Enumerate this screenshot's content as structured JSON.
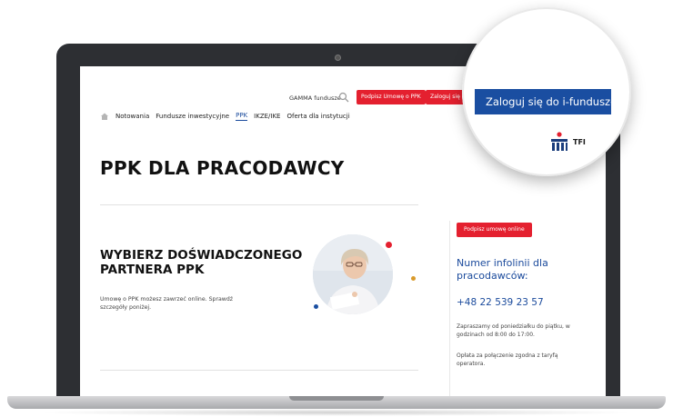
{
  "header": {
    "gamma_link": "GAMMA fundusze",
    "sign_button": "Podpisz Umowę o PPK",
    "login_button": "Zaloguj się do i-",
    "nav": [
      "Notowania",
      "Fundusze inwestycyjne",
      "PPK",
      "IKZE/IKE",
      "Oferta dla instytucji"
    ],
    "active_nav": "PPK"
  },
  "page": {
    "title": "PPK DLA PRACODAWCY",
    "hero_heading": "WYBIERZ DOŚWIADCZONEGO PARTNERA PPK",
    "hero_text": "Umowę o PPK możesz zawrzeć online. Sprawdź szczegóły poniżej."
  },
  "sidebar": {
    "sign_online": "Podpisz umowę online",
    "title": "Numer infolinii dla pracodawców:",
    "phone": "+48 22 539 23 57",
    "hours": "Zapraszamy od poniedziałku do piątku, w godzinach od 8:00 do 17:00.",
    "fee": "Opłata za połączenie zgodna z taryfą operatora."
  },
  "magnifier": {
    "login_full": "Zaloguj się do i-fundusze",
    "brand": "TFI"
  },
  "colors": {
    "accent_red": "#e4202f",
    "brand_blue": "#1a4ea1",
    "frame": "#2d2f33"
  }
}
